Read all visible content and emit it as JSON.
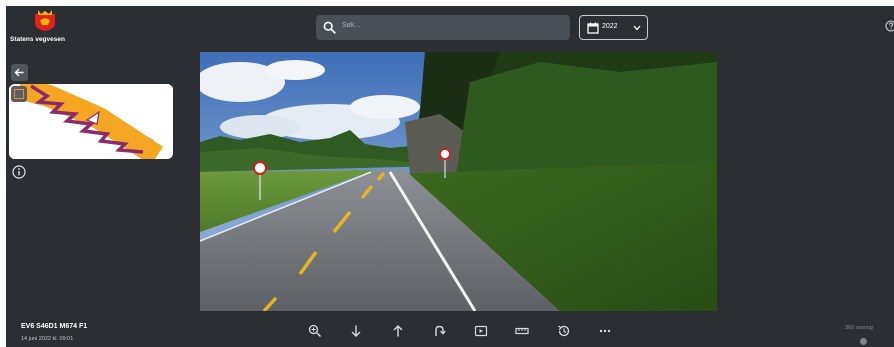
{
  "header": {
    "brand": "Statens vegvesen",
    "search_placeholder": "Søk...",
    "year": "2022"
  },
  "location": {
    "road_id": "EV6 S46D1 M674 F1",
    "date": "14 juni 2022 kl. 09:01"
  },
  "toolbar": {
    "items": [
      "zoom-in",
      "step-backward",
      "step-forward",
      "turn-around",
      "play",
      "measure",
      "history",
      "more"
    ]
  },
  "view_360": "360 visning",
  "colors": {
    "app_bg": "#2b2f34",
    "search_bg": "#4a5058",
    "brand_red": "#e2231a",
    "brand_yellow": "#f7b500",
    "road_orange": "#f28a20",
    "road_purple": "#8e2a6b"
  }
}
